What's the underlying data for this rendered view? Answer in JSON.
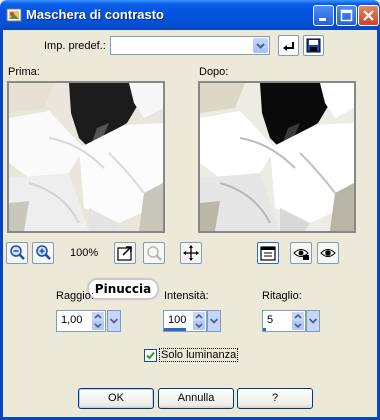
{
  "window": {
    "title": "Maschera di contrasto"
  },
  "preset": {
    "label": "Imp. predef.:",
    "value": ""
  },
  "previews": {
    "before_label": "Prima:",
    "after_label": "Dopo:"
  },
  "zoom": {
    "level": "100%"
  },
  "params": {
    "radius": {
      "label": "Raggio:",
      "value": "1,00"
    },
    "intensity": {
      "label": "Intensità:",
      "value": "100"
    },
    "clipping": {
      "label": "Ritaglio:",
      "value": "5"
    }
  },
  "watermark": {
    "text": "Pinuccia"
  },
  "luminance": {
    "label": "Solo luminanza",
    "checked": true
  },
  "buttons": {
    "ok": "OK",
    "cancel": "Annulla",
    "help": "?"
  },
  "colors": {
    "titlebar": "#0454e0",
    "face": "#ece9d8",
    "accent": "#316ac5"
  }
}
